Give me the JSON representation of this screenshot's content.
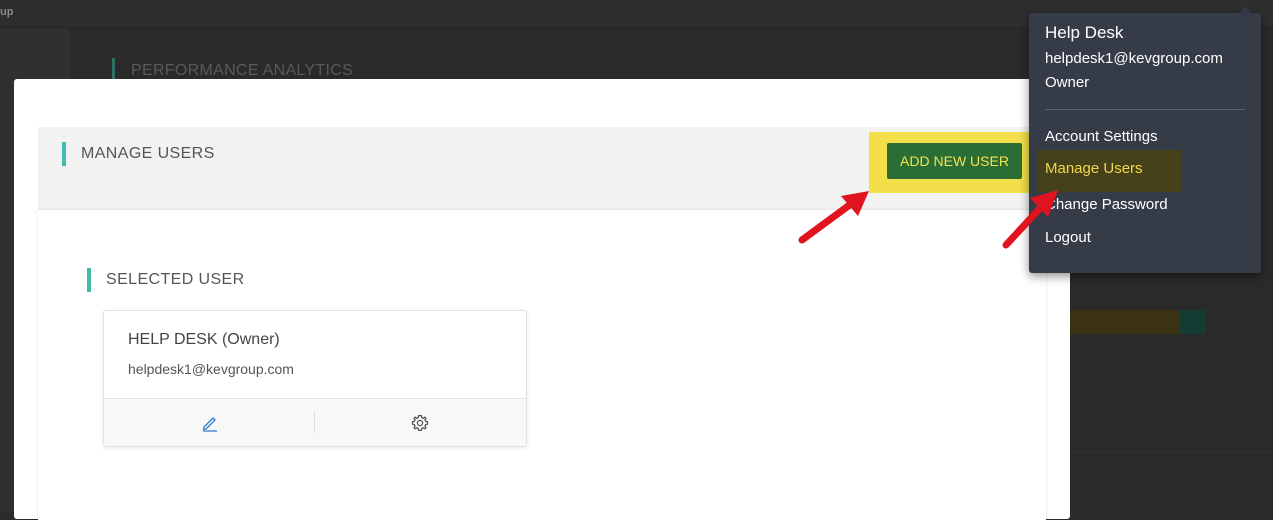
{
  "background": {
    "app_name": "up",
    "section_title": "PERFORMANCE ANALYTICS"
  },
  "manage_users": {
    "title": "MANAGE USERS",
    "add_button_label": "ADD NEW USER",
    "selected_user_title": "SELECTED USER",
    "selected_user": {
      "name": "HELP DESK (Owner)",
      "email": "helpdesk1@kevgroup.com",
      "actions": [
        "edit-icon",
        "gear-icon"
      ]
    }
  },
  "user_menu": {
    "name": "Help Desk",
    "email": "helpdesk1@kevgroup.com",
    "role": "Owner",
    "items": [
      {
        "label": "Account Settings",
        "active": false
      },
      {
        "label": "Manage Users",
        "active": true
      },
      {
        "label": "Change Password",
        "active": false
      },
      {
        "label": "Logout",
        "active": false
      }
    ]
  },
  "colors": {
    "accent": "#3dbea8",
    "add_button_bg": "#2a6e36",
    "highlight": "#f2df4a",
    "annotation_arrow": "#e0141e",
    "menu_bg": "#363b48"
  }
}
